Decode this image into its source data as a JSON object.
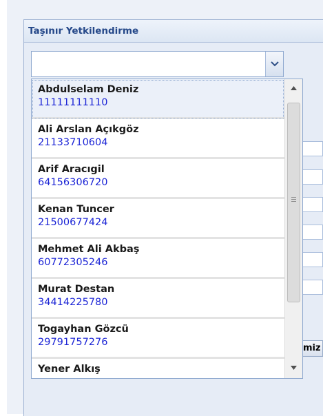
{
  "panel": {
    "title": "Taşınır Yetkilendirme"
  },
  "combo": {
    "value": "",
    "trigger_icon": "chevron-down-icon"
  },
  "background": {
    "button_label_fragment": "miz"
  },
  "dropdown": {
    "items": [
      {
        "name": "Abdulselam Deniz",
        "id": "11111111110"
      },
      {
        "name": "Ali Arslan Açıkgöz",
        "id": "21133710604"
      },
      {
        "name": "Arif Aracıgil",
        "id": "64156306720"
      },
      {
        "name": "Kenan Tuncer",
        "id": "21500677424"
      },
      {
        "name": "Mehmet Ali Akbaş",
        "id": "60772305246"
      },
      {
        "name": "Murat Destan",
        "id": "34414225780"
      },
      {
        "name": "Togayhan Gözcü",
        "id": "29791757276"
      },
      {
        "name": "Yener Alkış",
        "id": ""
      }
    ],
    "selected_index": 0
  },
  "colors": {
    "title": "#254889",
    "item_id": "#1c25d6",
    "border": "#8ea8cf"
  }
}
